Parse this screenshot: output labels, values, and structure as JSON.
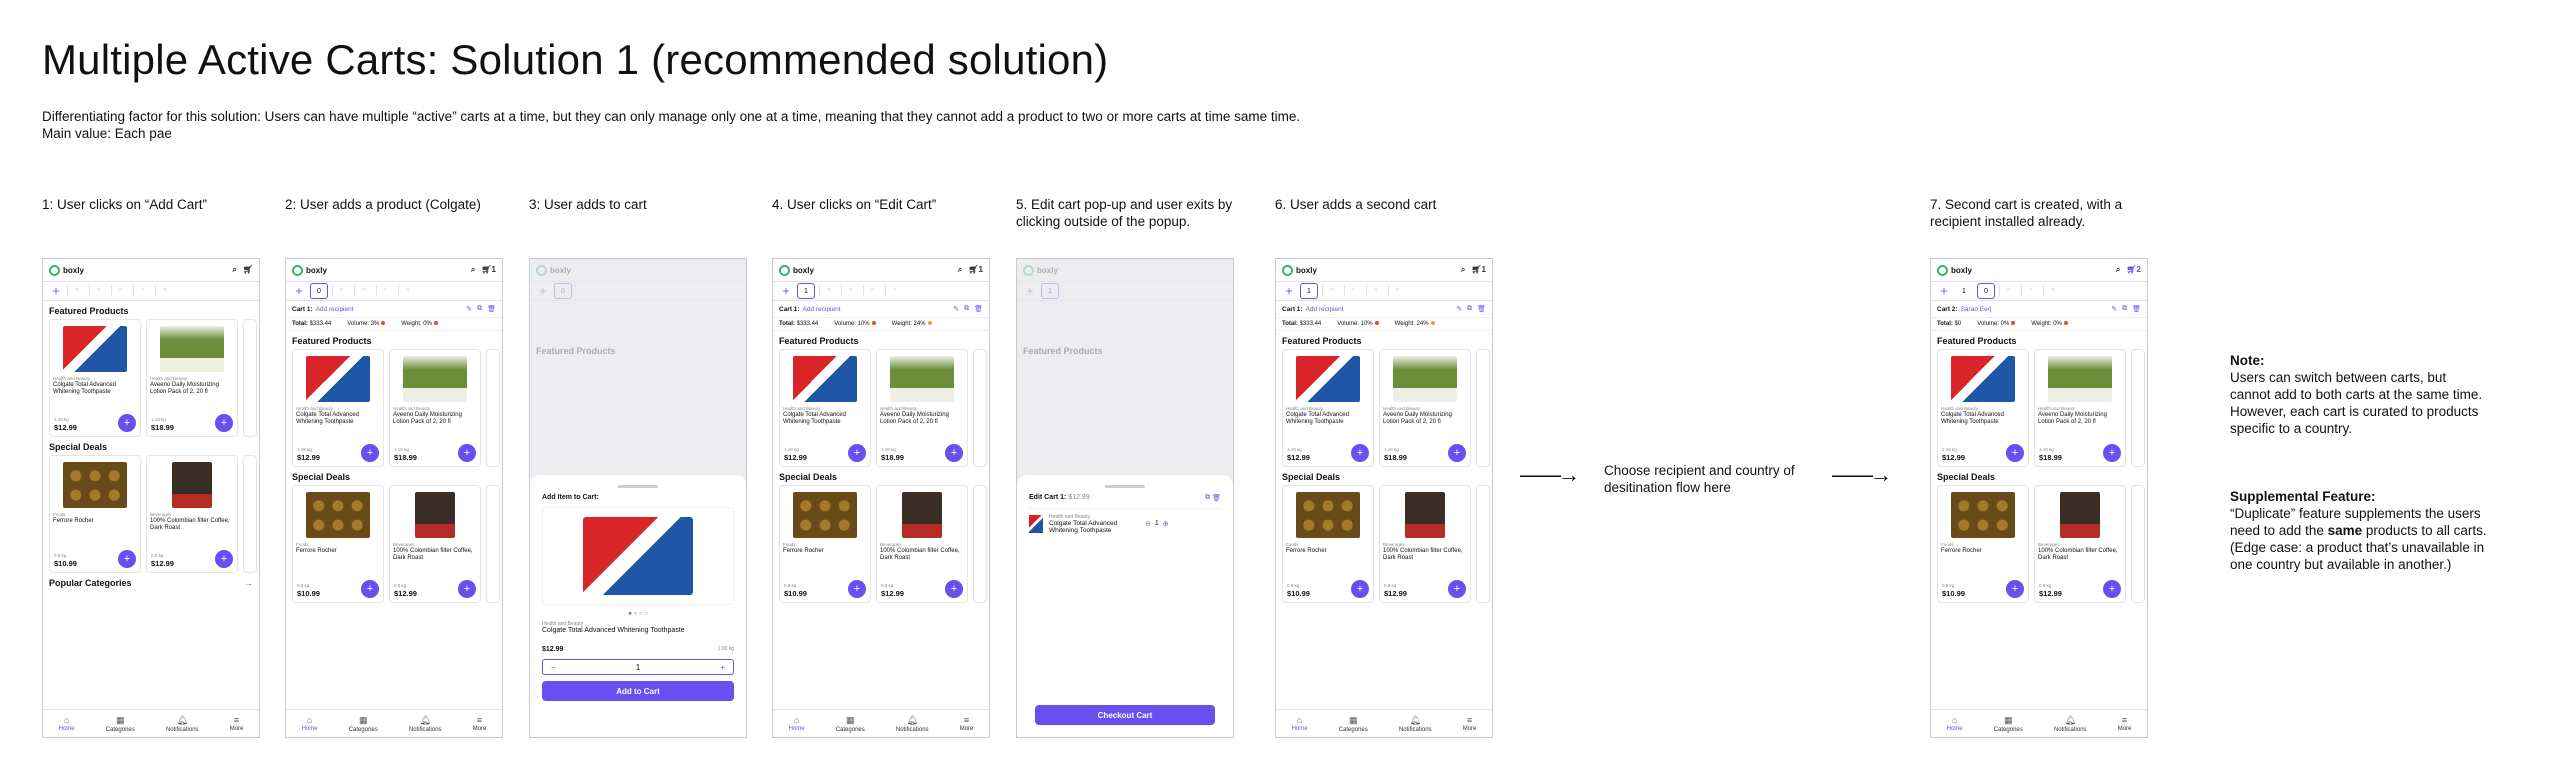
{
  "page": {
    "title": "Multiple Active Carts: Solution 1 (recommended solution)",
    "description_line1": "Differentiating factor for this solution: Users can have multiple “active” carts at a time, but they can only manage only one at a time, meaning that they cannot add a product to two or more carts at time same time.",
    "description_line2": "Main value: Each pae"
  },
  "steps": [
    {
      "label": "1: User clicks on “Add Cart”"
    },
    {
      "label": "2: User adds a product (Colgate)"
    },
    {
      "label": "3: User adds to cart"
    },
    {
      "label": "4. User clicks on “Edit Cart”"
    },
    {
      "label": "5. Edit cart pop-up and user exits by clicking outside of the popup."
    },
    {
      "label": "6. User adds a second cart"
    },
    {
      "label": "7. Second cart is created, with a recipient installed already."
    }
  ],
  "flow": {
    "middle_text": "Choose recipient and country of desitination flow here"
  },
  "notes": {
    "note_title": "Note:",
    "note_body": "Users can switch between carts, but cannot add to both carts at the same time. However, each cart is curated to products specific to a country.",
    "supp_title": "Supplemental Feature:",
    "supp_body_1": "“Duplicate” feature supplements the users need to add the ",
    "supp_bold": "same",
    "supp_body_2": " products to all carts. (Edge case: a product that’s unavailable in one country but available in another.)"
  },
  "app": {
    "brand": "boxly",
    "cart_count": "1",
    "cart_count_2": "2",
    "tab_zero": "0",
    "tab_one": "1",
    "cart1_label": "Cart 1:",
    "cart2_label": "Cart 2:",
    "add_recipient": "Add recipient",
    "recipient2": "Sarao Eerj",
    "total_label": "Total:",
    "total_value": "$333.44",
    "total_zero": "$0",
    "volume_label": "Volume:",
    "volume_a": "3%",
    "volume_b": "10%",
    "volume_c": "0%",
    "weight_label": "Weight:",
    "weight_a": "0%",
    "weight_b": "24%",
    "featured": "Featured Products",
    "special": "Special Deals",
    "popular": "Popular Categories",
    "products": {
      "colgate_cat": "Health and Beauty",
      "colgate_name": "Colgate Total Advanced Whitening Toothpaste",
      "colgate_wt": "1.18 kg",
      "colgate_price": "$12.99",
      "aveeno_cat": "Health and Beauty",
      "aveeno_name": "Aveeno Daily Moisturizing Lotion Pack of 2, 20 fl",
      "aveeno_wt": "1.18 kg",
      "aveeno_price": "$18.99",
      "ferrero_cat": "Foods",
      "ferrero_name": "Ferrore Rocher",
      "ferrero_wt": "0.8 kg",
      "ferrero_price": "$10.99",
      "coffee_cat": "Beverages",
      "coffee_name": "100% Colombian filter Coffee, Dark Roast",
      "coffee_wt": "0.8 kg",
      "coffee_price": "$12.99"
    },
    "nav": [
      "Home",
      "Categories",
      "Notifications",
      "More"
    ],
    "add_sheet": {
      "heading": "Add Item to Cart:",
      "cat": "Health and Beauty",
      "name": "Colgate Total Advanced Whitening Toothpaste",
      "price": "$12.99",
      "wt": "1.00 kg",
      "qty": "1",
      "button": "Add to Cart"
    },
    "edit_sheet": {
      "heading": "Edit Cart 1:",
      "amount": "$12.99",
      "cat": "Health and Beauty",
      "name": "Colgate Total Advanced Whitening Toothpaste",
      "qty": "1",
      "button": "Checkout Cart"
    }
  }
}
